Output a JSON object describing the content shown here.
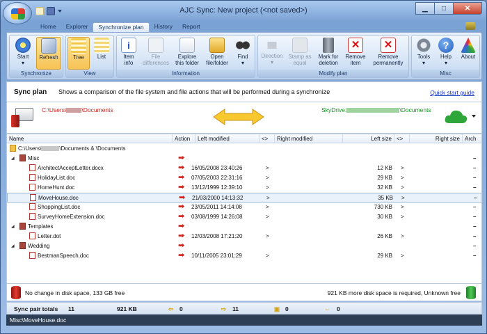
{
  "window": {
    "title": "AJC Sync:  New project (<not saved>)"
  },
  "tabs": [
    "Home",
    "Explorer",
    "Synchronize plan",
    "History",
    "Report"
  ],
  "ribbon": {
    "groups": {
      "synchronize": "Synchronize",
      "view": "View",
      "information": "Information",
      "modify": "Modify plan",
      "misc": "Misc"
    },
    "buttons": {
      "start": "Start",
      "refresh": "Refresh",
      "tree": "Tree",
      "list": "List",
      "item_info_1": "Item",
      "item_info_2": "info",
      "file_diff_1": "File",
      "file_diff_2": "differences",
      "explore_1": "Explore",
      "explore_2": "this folder",
      "open_1": "Open",
      "open_2": "file/folder",
      "find": "Find",
      "direction": "Direction",
      "stamp_1": "Stamp as",
      "stamp_2": "equal",
      "mark_1": "Mark for",
      "mark_2": "deletion",
      "remove_1": "Remove",
      "remove_2": "item",
      "removep_1": "Remove",
      "removep_2": "permanently",
      "tools": "Tools",
      "help": "Help",
      "about": "About"
    }
  },
  "plan": {
    "title": "Sync plan",
    "description": "Shows a comparison of the file system and file actions that will be performed during a synchronize",
    "quick_start": "Quick start guide"
  },
  "paths": {
    "left_prefix": "C:\\Users\\",
    "left_suffix": "\\Documents",
    "right_prefix": "SkyDrive:",
    "right_suffix": "\\Documents"
  },
  "columns": [
    "Name",
    "Action",
    "Left modified",
    "<>",
    "Right modified",
    "Left size",
    "<>",
    "Right size",
    "Arch"
  ],
  "root": {
    "prefix": "C:\\Users\\",
    "suffix": "\\Documents & \\Documents"
  },
  "rows": [
    {
      "name": "Misc",
      "type": "folder",
      "level": 1
    },
    {
      "name": "ArchitectAcceptLetter.docx",
      "modified": "16/05/2008 23:40:26",
      "cmp": ">",
      "size": "12 KB",
      "level": 2
    },
    {
      "name": "HolidayList.doc",
      "modified": "07/05/2003 22:31:16",
      "cmp": ">",
      "size": "29 KB",
      "level": 2
    },
    {
      "name": "HomeHunt.doc",
      "modified": "13/12/1999 12:39:10",
      "cmp": ">",
      "size": "32 KB",
      "level": 2
    },
    {
      "name": "MoveHouse.doc",
      "modified": "21/03/2000 14:13:32",
      "cmp": ">",
      "size": "35 KB",
      "level": 2,
      "selected": true
    },
    {
      "name": "ShoppingList.doc",
      "modified": "23/05/2011 14:14:08",
      "cmp": ">",
      "size": "730 KB",
      "level": 2
    },
    {
      "name": "SurveyHomeExtension.doc",
      "modified": "03/08/1999 14:26:08",
      "cmp": ">",
      "size": "30 KB",
      "level": 2
    },
    {
      "name": "Templates",
      "type": "folder",
      "level": 1
    },
    {
      "name": "Letter.dot",
      "modified": "12/03/2008 17:21:20",
      "cmp": ">",
      "size": "26 KB",
      "level": 2
    },
    {
      "name": "Wedding",
      "type": "folder",
      "level": 1
    },
    {
      "name": "BestmanSpeech.doc",
      "modified": "10/11/2005 23:01:29",
      "cmp": ">",
      "size": "29 KB",
      "level": 2
    }
  ],
  "status": {
    "left": "No change in disk space, 133 GB free",
    "right": "921 KB more disk space is required, Unknown free"
  },
  "totals": {
    "label": "Sync pair totals",
    "count": "11",
    "size": "921 KB",
    "left": "0",
    "right": "11",
    "del": "0",
    "both": "0"
  },
  "statusbar": "Misc\\MoveHouse.doc"
}
